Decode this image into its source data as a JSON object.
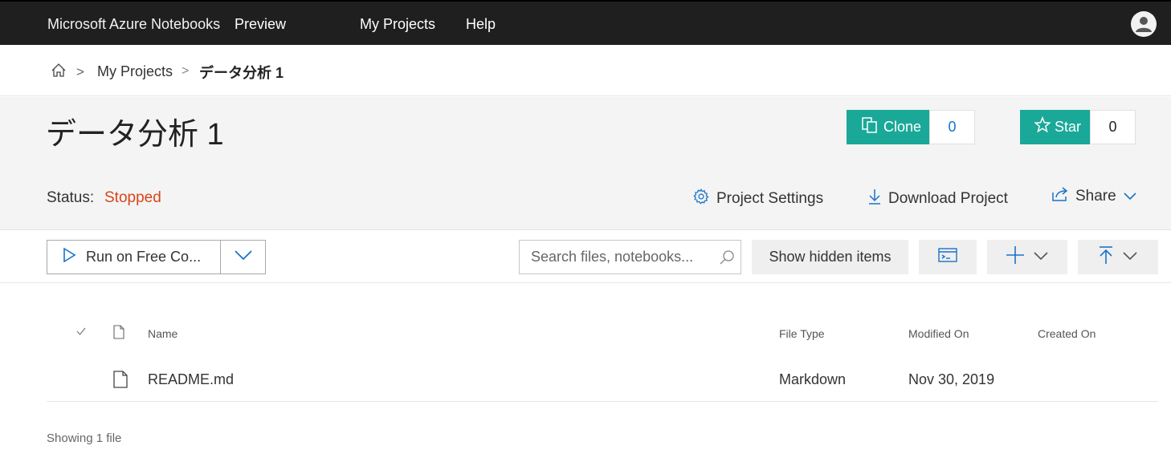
{
  "topnav": {
    "brand": "Microsoft Azure Notebooks",
    "preview": "Preview",
    "links": [
      "My Projects",
      "Help"
    ],
    "avatar_icon": "user-avatar-icon"
  },
  "breadcrumb": {
    "home_icon": "home-icon",
    "separator": ">",
    "items": [
      "My Projects",
      "データ分析 1"
    ]
  },
  "project": {
    "title": "データ分析 1",
    "clone_label": "Clone",
    "clone_count": "0",
    "star_label": "Star",
    "star_count": "0",
    "status_label": "Status:",
    "status_value": "Stopped",
    "actions": {
      "settings": "Project Settings",
      "download": "Download Project",
      "share": "Share"
    }
  },
  "toolbar": {
    "run_label": "Run on Free Co...",
    "search_placeholder": "Search files, notebooks...",
    "show_hidden": "Show hidden items"
  },
  "table": {
    "columns": [
      "Name",
      "File Type",
      "Modified On",
      "Created On"
    ],
    "rows": [
      {
        "name": "README.md",
        "type": "Markdown",
        "modified": "Nov 30, 2019",
        "created": ""
      }
    ]
  },
  "footer": "Showing 1 file",
  "colors": {
    "topbar": "#1f1f1f",
    "accent": "#1aa898",
    "status_stopped": "#d9441c",
    "link_blue": "#1a73c8"
  }
}
